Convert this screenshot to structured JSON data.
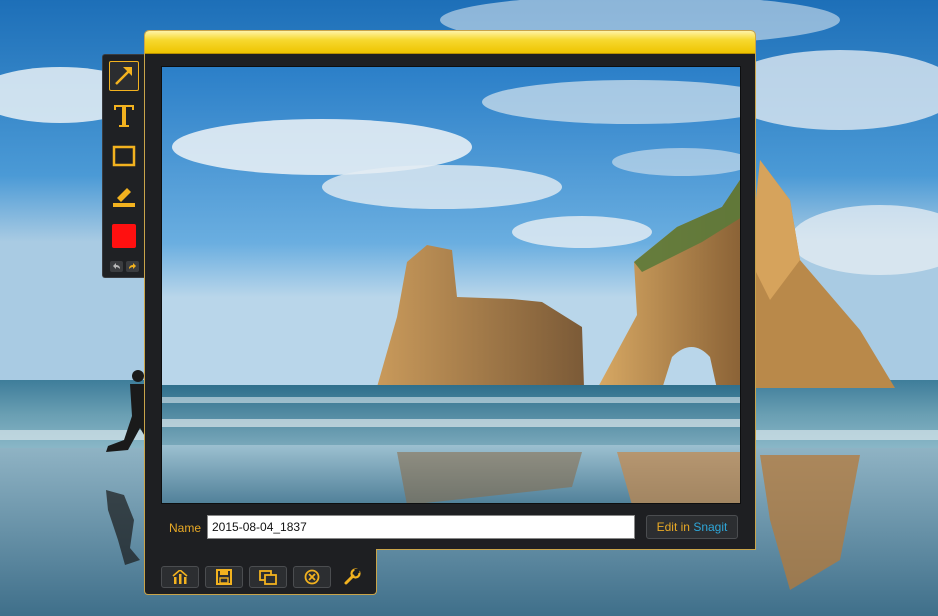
{
  "palette": {
    "tools": [
      {
        "name": "arrow-tool",
        "icon": "arrow-icon",
        "selected": true
      },
      {
        "name": "text-tool",
        "icon": "text-T-icon",
        "selected": false
      },
      {
        "name": "rectangle-tool",
        "icon": "rectangle-icon",
        "selected": false
      },
      {
        "name": "highlighter-tool",
        "icon": "highlighter-icon",
        "selected": false
      },
      {
        "name": "color-swatch",
        "icon": "color-swatch",
        "selected": false
      }
    ],
    "accent_color": "#f2b21f",
    "swatch_color": "#ff1010"
  },
  "capture": {
    "name_label": "Name",
    "name_value": "2015-08-04_1837",
    "edit_label_1": "Edit in",
    "edit_label_2": "Snagit"
  },
  "actions": [
    {
      "name": "share-button",
      "icon": "share-icon"
    },
    {
      "name": "save-button",
      "icon": "floppy-disk-icon"
    },
    {
      "name": "copy-button",
      "icon": "copy-icon"
    },
    {
      "name": "close-button",
      "icon": "close-circle-icon"
    },
    {
      "name": "settings-button",
      "icon": "wrench-icon"
    }
  ],
  "colors": {
    "titlebar": "#f7d930",
    "frame_border": "#c9a44a",
    "frame_bg": "#1e1f22",
    "label_orange": "#e8a926",
    "snagit_blue": "#2ea6d8"
  }
}
